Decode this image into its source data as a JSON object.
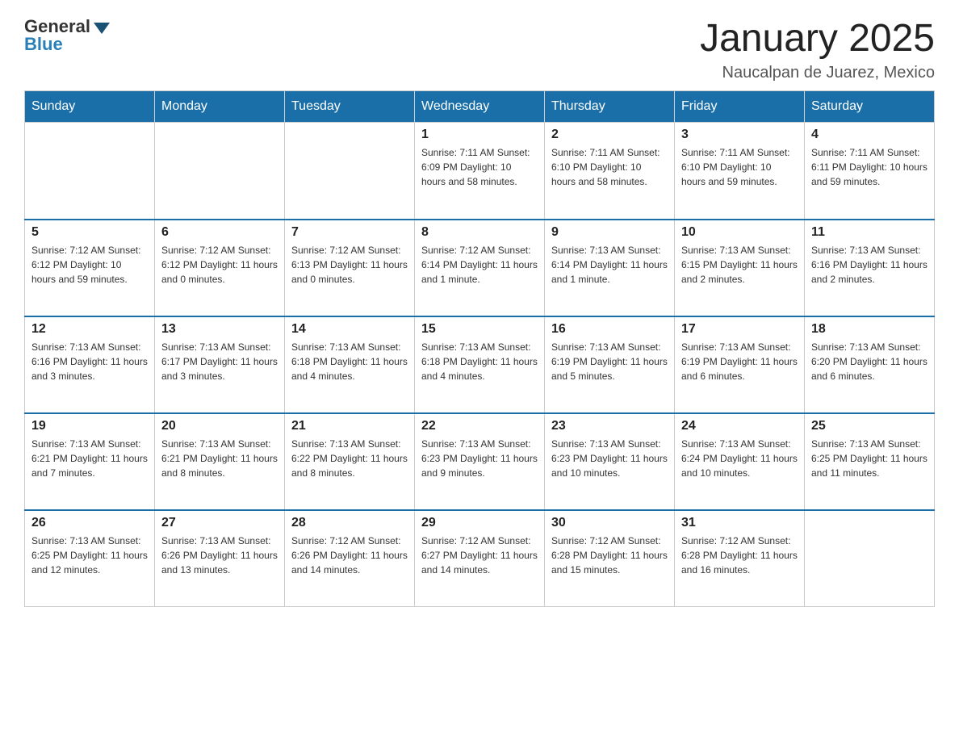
{
  "header": {
    "logo_general": "General",
    "logo_blue": "Blue",
    "title": "January 2025",
    "subtitle": "Naucalpan de Juarez, Mexico"
  },
  "days_of_week": [
    "Sunday",
    "Monday",
    "Tuesday",
    "Wednesday",
    "Thursday",
    "Friday",
    "Saturday"
  ],
  "weeks": [
    [
      {
        "day": "",
        "info": ""
      },
      {
        "day": "",
        "info": ""
      },
      {
        "day": "",
        "info": ""
      },
      {
        "day": "1",
        "info": "Sunrise: 7:11 AM\nSunset: 6:09 PM\nDaylight: 10 hours\nand 58 minutes."
      },
      {
        "day": "2",
        "info": "Sunrise: 7:11 AM\nSunset: 6:10 PM\nDaylight: 10 hours\nand 58 minutes."
      },
      {
        "day": "3",
        "info": "Sunrise: 7:11 AM\nSunset: 6:10 PM\nDaylight: 10 hours\nand 59 minutes."
      },
      {
        "day": "4",
        "info": "Sunrise: 7:11 AM\nSunset: 6:11 PM\nDaylight: 10 hours\nand 59 minutes."
      }
    ],
    [
      {
        "day": "5",
        "info": "Sunrise: 7:12 AM\nSunset: 6:12 PM\nDaylight: 10 hours\nand 59 minutes."
      },
      {
        "day": "6",
        "info": "Sunrise: 7:12 AM\nSunset: 6:12 PM\nDaylight: 11 hours\nand 0 minutes."
      },
      {
        "day": "7",
        "info": "Sunrise: 7:12 AM\nSunset: 6:13 PM\nDaylight: 11 hours\nand 0 minutes."
      },
      {
        "day": "8",
        "info": "Sunrise: 7:12 AM\nSunset: 6:14 PM\nDaylight: 11 hours\nand 1 minute."
      },
      {
        "day": "9",
        "info": "Sunrise: 7:13 AM\nSunset: 6:14 PM\nDaylight: 11 hours\nand 1 minute."
      },
      {
        "day": "10",
        "info": "Sunrise: 7:13 AM\nSunset: 6:15 PM\nDaylight: 11 hours\nand 2 minutes."
      },
      {
        "day": "11",
        "info": "Sunrise: 7:13 AM\nSunset: 6:16 PM\nDaylight: 11 hours\nand 2 minutes."
      }
    ],
    [
      {
        "day": "12",
        "info": "Sunrise: 7:13 AM\nSunset: 6:16 PM\nDaylight: 11 hours\nand 3 minutes."
      },
      {
        "day": "13",
        "info": "Sunrise: 7:13 AM\nSunset: 6:17 PM\nDaylight: 11 hours\nand 3 minutes."
      },
      {
        "day": "14",
        "info": "Sunrise: 7:13 AM\nSunset: 6:18 PM\nDaylight: 11 hours\nand 4 minutes."
      },
      {
        "day": "15",
        "info": "Sunrise: 7:13 AM\nSunset: 6:18 PM\nDaylight: 11 hours\nand 4 minutes."
      },
      {
        "day": "16",
        "info": "Sunrise: 7:13 AM\nSunset: 6:19 PM\nDaylight: 11 hours\nand 5 minutes."
      },
      {
        "day": "17",
        "info": "Sunrise: 7:13 AM\nSunset: 6:19 PM\nDaylight: 11 hours\nand 6 minutes."
      },
      {
        "day": "18",
        "info": "Sunrise: 7:13 AM\nSunset: 6:20 PM\nDaylight: 11 hours\nand 6 minutes."
      }
    ],
    [
      {
        "day": "19",
        "info": "Sunrise: 7:13 AM\nSunset: 6:21 PM\nDaylight: 11 hours\nand 7 minutes."
      },
      {
        "day": "20",
        "info": "Sunrise: 7:13 AM\nSunset: 6:21 PM\nDaylight: 11 hours\nand 8 minutes."
      },
      {
        "day": "21",
        "info": "Sunrise: 7:13 AM\nSunset: 6:22 PM\nDaylight: 11 hours\nand 8 minutes."
      },
      {
        "day": "22",
        "info": "Sunrise: 7:13 AM\nSunset: 6:23 PM\nDaylight: 11 hours\nand 9 minutes."
      },
      {
        "day": "23",
        "info": "Sunrise: 7:13 AM\nSunset: 6:23 PM\nDaylight: 11 hours\nand 10 minutes."
      },
      {
        "day": "24",
        "info": "Sunrise: 7:13 AM\nSunset: 6:24 PM\nDaylight: 11 hours\nand 10 minutes."
      },
      {
        "day": "25",
        "info": "Sunrise: 7:13 AM\nSunset: 6:25 PM\nDaylight: 11 hours\nand 11 minutes."
      }
    ],
    [
      {
        "day": "26",
        "info": "Sunrise: 7:13 AM\nSunset: 6:25 PM\nDaylight: 11 hours\nand 12 minutes."
      },
      {
        "day": "27",
        "info": "Sunrise: 7:13 AM\nSunset: 6:26 PM\nDaylight: 11 hours\nand 13 minutes."
      },
      {
        "day": "28",
        "info": "Sunrise: 7:12 AM\nSunset: 6:26 PM\nDaylight: 11 hours\nand 14 minutes."
      },
      {
        "day": "29",
        "info": "Sunrise: 7:12 AM\nSunset: 6:27 PM\nDaylight: 11 hours\nand 14 minutes."
      },
      {
        "day": "30",
        "info": "Sunrise: 7:12 AM\nSunset: 6:28 PM\nDaylight: 11 hours\nand 15 minutes."
      },
      {
        "day": "31",
        "info": "Sunrise: 7:12 AM\nSunset: 6:28 PM\nDaylight: 11 hours\nand 16 minutes."
      },
      {
        "day": "",
        "info": ""
      }
    ]
  ]
}
